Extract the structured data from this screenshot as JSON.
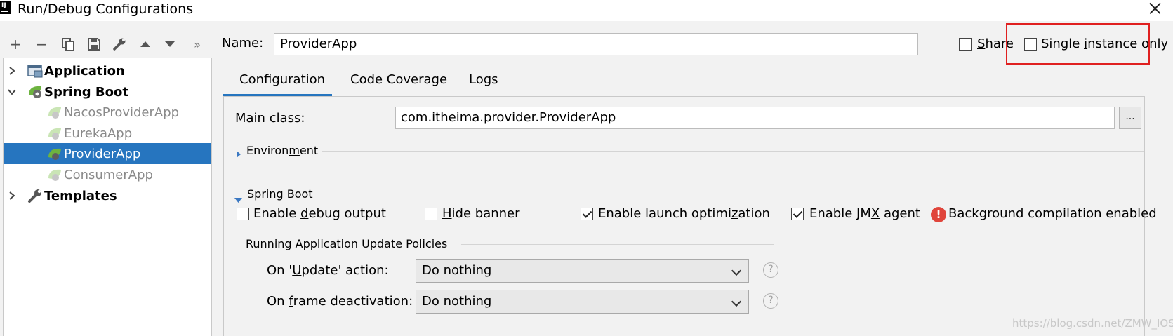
{
  "window": {
    "title": "Run/Debug Configurations",
    "app_icon_text": "IJ"
  },
  "toolbar": {
    "add": "+",
    "remove": "−",
    "more": "»"
  },
  "tree": {
    "items": [
      {
        "label": "Application",
        "icon": "application-icon",
        "expanded": false
      },
      {
        "label": "Spring Boot",
        "icon": "spring-boot-icon",
        "expanded": true
      },
      {
        "label": "NacosProviderApp",
        "icon": "spring-boot-leaf-icon"
      },
      {
        "label": "EurekaApp",
        "icon": "spring-boot-leaf-icon"
      },
      {
        "label": "ProviderApp",
        "icon": "spring-boot-leaf-icon",
        "selected": true
      },
      {
        "label": "ConsumerApp",
        "icon": "spring-boot-leaf-icon"
      },
      {
        "label": "Templates",
        "icon": "wrench-icon",
        "expanded": false
      }
    ]
  },
  "header": {
    "name_label_mnemonic": "N",
    "name_label_rest": "ame:",
    "name_value": "ProviderApp",
    "share_mnemonic": "S",
    "share_rest": "hare",
    "share_checked": false,
    "single_instance_pre": "Single ",
    "single_instance_mnemonic": "i",
    "single_instance_post": "nstance only",
    "single_instance_checked": false
  },
  "tabs": [
    {
      "label": "Configuration",
      "active": true
    },
    {
      "label": "Code Coverage",
      "active": false
    },
    {
      "label": "Logs",
      "active": false
    }
  ],
  "config": {
    "main_class_label": "Main class:",
    "main_class_value": "com.itheima.provider.ProviderApp",
    "browse_label": "...",
    "environment_pre": "Environ",
    "environment_mnemonic": "m",
    "environment_post": "ent",
    "spring_boot_pre": "Spring ",
    "spring_boot_mnemonic": "B",
    "spring_boot_post": "oot",
    "checkboxes": [
      {
        "pre": "Enable ",
        "mnemonic": "d",
        "post": "ebug output",
        "checked": false
      },
      {
        "pre": "",
        "mnemonic": "H",
        "post": "ide banner",
        "checked": false
      },
      {
        "pre": "Enable launch optimi",
        "mnemonic": "z",
        "post": "ation",
        "checked": true
      },
      {
        "pre": "Enable JM",
        "mnemonic": "X",
        "post": " agent",
        "checked": true
      }
    ],
    "background_compilation": "Background compilation enabled",
    "policies_title": "Running Application Update Policies",
    "update_action_pre": "On '",
    "update_action_mnemonic": "U",
    "update_action_post": "pdate' action:",
    "update_action_value": "Do nothing",
    "frame_deactivation_pre": "On ",
    "frame_deactivation_mnemonic": "f",
    "frame_deactivation_post": "rame deactivation:",
    "frame_deactivation_value": "Do nothing",
    "help_glyph": "?"
  },
  "watermark": "https://blog.csdn.net/ZMW_IOS",
  "colors": {
    "accent": "#2675bf",
    "highlight_box": "#e02020",
    "error": "#e0453b",
    "spring_green": "#6db33f"
  }
}
